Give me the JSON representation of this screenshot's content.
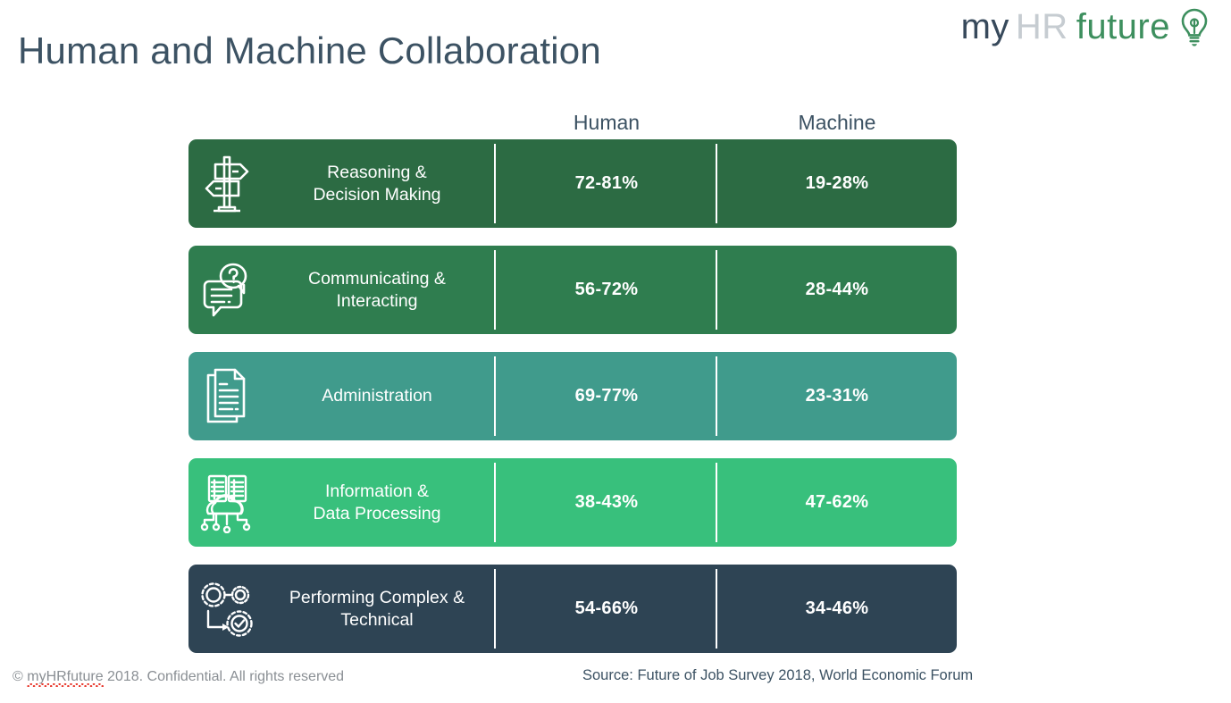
{
  "logo": {
    "part1": "my",
    "part2": "HR",
    "part3": "future",
    "icon": "lightbulb-icon",
    "color_my": "#37495b",
    "color_hr": "#c6ccd1",
    "color_future": "#3d8f5e"
  },
  "header": {
    "title": "Human and Machine Collaboration",
    "title_color": "#3c5263"
  },
  "table": {
    "columns": [
      {
        "key": "label",
        "label": ""
      },
      {
        "key": "human",
        "label": "Human"
      },
      {
        "key": "machine",
        "label": "Machine"
      }
    ],
    "rows": [
      {
        "icon": "signpost-icon",
        "label": "Reasoning &\nDecision Making",
        "human": "72-81%",
        "machine": "19-28%",
        "color": "#2c6b43"
      },
      {
        "icon": "speech-bubbles-question-icon",
        "label": "Communicating &\nInteracting",
        "human": "56-72%",
        "machine": "28-44%",
        "color": "#2f7d4f"
      },
      {
        "icon": "documents-icon",
        "label": "Administration",
        "human": "69-77%",
        "machine": "23-31%",
        "color": "#409b8c"
      },
      {
        "icon": "server-cloud-icon",
        "label": "Information &\nData Processing",
        "human": "38-43%",
        "machine": "47-62%",
        "color": "#38c07c"
      },
      {
        "icon": "gears-workflow-icon",
        "label": "Performing Complex &\nTechnical",
        "human": "54-66%",
        "machine": "34-46%",
        "color": "#2e4454"
      }
    ]
  },
  "footer": {
    "copyright_prefix": "© ",
    "copyright_brand": "myHRfuture",
    "copyright_suffix": " 2018. Confidential. All rights reserved",
    "source": "Source: Future of Job Survey 2018, World Economic Forum"
  },
  "chart_data": {
    "type": "table",
    "title": "Human and Machine Collaboration",
    "categories": [
      "Reasoning & Decision Making",
      "Communicating & Interacting",
      "Administration",
      "Information & Data Processing",
      "Performing Complex & Technical"
    ],
    "series": [
      {
        "name": "Human",
        "values": [
          "72-81%",
          "56-72%",
          "69-77%",
          "38-43%",
          "54-66%"
        ]
      },
      {
        "name": "Machine",
        "values": [
          "19-28%",
          "28-44%",
          "23-31%",
          "47-62%",
          "34-46%"
        ]
      }
    ],
    "source": "Source: Future of Job Survey 2018, World Economic Forum"
  }
}
